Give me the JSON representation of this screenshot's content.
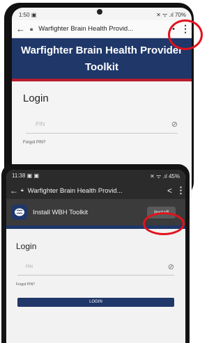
{
  "screen_top": {
    "status": {
      "time": "1:50",
      "left_icons": "▣",
      "right": "✕ ᯤ .ıl 70%"
    },
    "browser": {
      "back_icon": "back-arrow-icon",
      "title": "Warfighter Brain Health Provid...",
      "menu_icon": "more-vert-icon"
    },
    "banner": {
      "title": "Warfighter Brain Health Provider Toolkit"
    },
    "login": {
      "heading": "Login",
      "pin_placeholder": "PIN",
      "forgot": "Forgot PIN?"
    }
  },
  "screen_bottom": {
    "status": {
      "time": "11:38",
      "left_icons": "▣ ▣",
      "right": "✕ ᯤ .ıl 45%"
    },
    "browser": {
      "back_icon": "back-arrow-icon",
      "title": "Warfighter Brain Health Provid...",
      "share_icon": "share-icon",
      "menu_icon": "more-vert-icon"
    },
    "install_banner": {
      "text": "Install WBH Toolkit",
      "button": "Install"
    },
    "login": {
      "heading": "Login",
      "pin_placeholder": "PIN",
      "forgot": "Forgot PIN?",
      "button": "LOGIN"
    }
  },
  "colors": {
    "navy": "#1f3769",
    "accent_red": "#b31f2e",
    "highlight_circle": "#e3121c"
  }
}
